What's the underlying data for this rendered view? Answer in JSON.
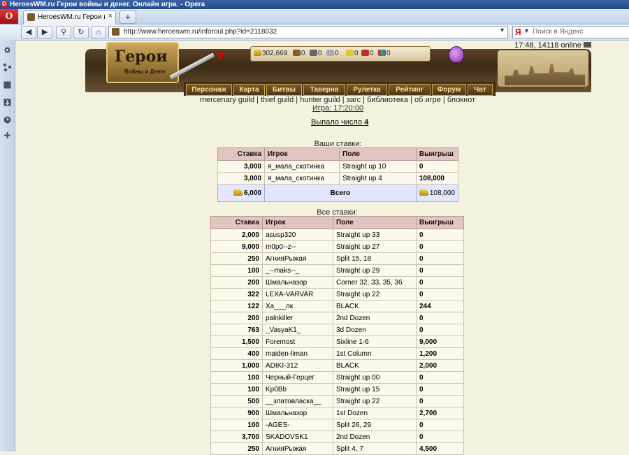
{
  "window": {
    "title": "HeroesWM.ru Герои войны и денег. Онлайн игра. - Opera"
  },
  "browser": {
    "opera_button": "O",
    "tab_label": "HeroesWM.ru Герои вой...",
    "tab_close": "×",
    "new_tab": "+",
    "address": "http://www.heroeswm.ru/inforoul.php?id=2118032",
    "search_engine": "Я",
    "search_placeholder": "Поиск в Яндекс"
  },
  "header": {
    "logo_title": "Герои",
    "logo_subtitle": "Войны и Денег",
    "gold": "302,669",
    "res1": "0",
    "res2": "0",
    "res3": "0",
    "res4": "0",
    "res5": "0",
    "res6": "0",
    "clock": "17:48, 14118 online",
    "menu": [
      "Персонаж",
      "Карта",
      "Битвы",
      "Таверна",
      "Рулетка",
      "Рейтинг",
      "Форум",
      "Чат"
    ]
  },
  "links": {
    "items": [
      "mercenary guild",
      "thief guild",
      "hunter guild",
      "загс",
      "библиотека",
      "об игре",
      "блокнот"
    ],
    "separator": " | ",
    "game_time": "Игра: 17:20:00"
  },
  "result": {
    "prefix": "Выпало число ",
    "number": "4"
  },
  "my_bets": {
    "caption": "Ваши ставки:",
    "headers": [
      "Ставка",
      "Игрок",
      "Поле",
      "Выигрыш"
    ],
    "rows": [
      [
        "3,000",
        "я_мала_скотинка",
        "Straight up 10",
        "0"
      ],
      [
        "3,000",
        "я_мала_скотинка",
        "Straight up 4",
        "108,000"
      ]
    ],
    "total": {
      "stake": "6,000",
      "label": "Всего",
      "win": "108,000"
    }
  },
  "all_bets": {
    "caption": "Все ставки:",
    "headers": [
      "Ставка",
      "Игрок",
      "Поле",
      "Выигрыш"
    ],
    "rows": [
      [
        "2,000",
        "asusp320",
        "Straight up 33",
        "0"
      ],
      [
        "9,000",
        "m0p0--z--",
        "Straight up 27",
        "0"
      ],
      [
        "250",
        "АгнияРыжая",
        "Split 15, 18",
        "0"
      ],
      [
        "100",
        "_--maks--_",
        "Straight up 29",
        "0"
      ],
      [
        "200",
        "Шмальназор",
        "Corner 32, 33, 35, 36",
        "0"
      ],
      [
        "322",
        "LEXA-VARVAR",
        "Straight up 22",
        "0"
      ],
      [
        "122",
        "Ха___лк",
        "BLACK",
        "244"
      ],
      [
        "200",
        "palnkiller",
        "2nd Dozen",
        "0"
      ],
      [
        "763",
        "_VasyaK1_",
        "3d Dozen",
        "0"
      ],
      [
        "1,500",
        "Foremost",
        "Sixline 1-6",
        "9,000"
      ],
      [
        "400",
        "maiden-liman",
        "1st Column",
        "1,200"
      ],
      [
        "1,000",
        "ADIKI-312",
        "BLACK",
        "2,000"
      ],
      [
        "100",
        "Черный-Герцег",
        "Straight up 00",
        "0"
      ],
      [
        "100",
        "Kp0Bb",
        "Straight up 15",
        "0"
      ],
      [
        "500",
        "__златовласка__",
        "Straight up 22",
        "0"
      ],
      [
        "900",
        "Шмальназор",
        "1st Dozen",
        "2,700"
      ],
      [
        "100",
        "-AGES-",
        "Split 26, 29",
        "0"
      ],
      [
        "3,700",
        "SKADOVSK1",
        "2nd Dozen",
        "0"
      ],
      [
        "250",
        "АгнияРыжая",
        "Split 4, 7",
        "4,500"
      ]
    ]
  }
}
